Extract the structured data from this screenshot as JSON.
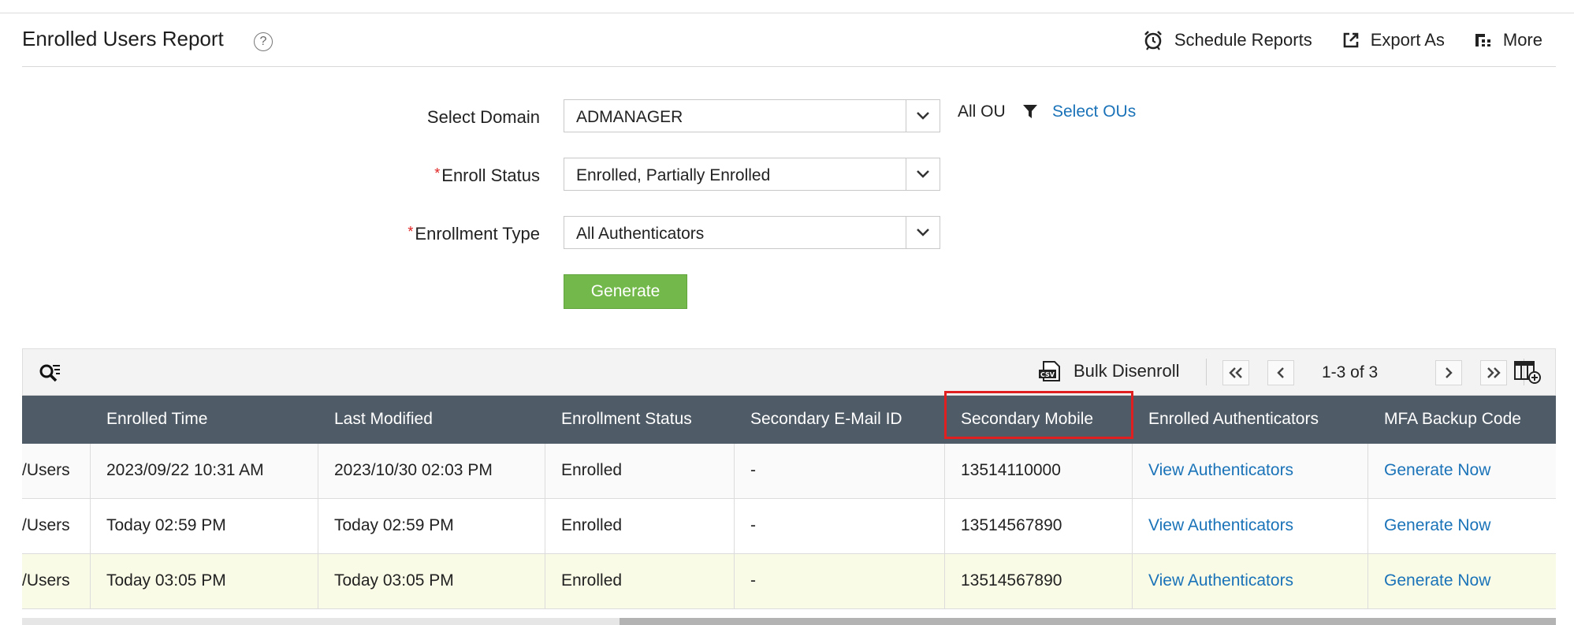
{
  "header": {
    "title": "Enrolled Users Report",
    "help_glyph": "?",
    "actions": [
      {
        "label": "Schedule Reports",
        "icon": "alarm-clock-icon"
      },
      {
        "label": "Export As",
        "icon": "export-icon"
      },
      {
        "label": "More",
        "icon": "more-icon"
      }
    ]
  },
  "form": {
    "domain_label": "Select Domain",
    "domain_value": "ADMANAGER",
    "status_label": "Enroll Status",
    "status_value": "Enrolled, Partially Enrolled",
    "type_label": "Enrollment Type",
    "type_value": "All Authenticators",
    "required_mark": "*",
    "ou_text": "All OU",
    "select_ous": "Select OUs",
    "generate_label": "Generate"
  },
  "toolbar": {
    "bulk_label": "Bulk Disenroll",
    "page_info": "1-3 of 3"
  },
  "table": {
    "headers": [
      "Enrolled Time",
      "Last Modified",
      "Enrollment Status",
      "Secondary E-Mail ID",
      "Secondary Mobile",
      "Enrolled Authenticators",
      "MFA Backup Code"
    ],
    "rows": [
      {
        "ou": "/Users",
        "enrolled_time": "2023/09/22 10:31 AM",
        "last_modified": "2023/10/30 02:03 PM",
        "status": "Enrolled",
        "email": "-",
        "mobile": "13514110000",
        "auth": "View Authenticators",
        "backup": "Generate Now"
      },
      {
        "ou": "/Users",
        "enrolled_time": "Today 02:59 PM",
        "last_modified": "Today 02:59 PM",
        "status": "Enrolled",
        "email": "-",
        "mobile": "13514567890",
        "auth": "View Authenticators",
        "backup": "Generate Now"
      },
      {
        "ou": "/Users",
        "enrolled_time": "Today 03:05 PM",
        "last_modified": "Today 03:05 PM",
        "status": "Enrolled",
        "email": "-",
        "mobile": "13514567890",
        "auth": "View Authenticators",
        "backup": "Generate Now"
      }
    ]
  },
  "colors": {
    "header_bg": "#4f5b66",
    "accent_green": "#72b84a",
    "link_blue": "#1a73b8",
    "highlight_red": "#e02020",
    "selected_row_bg": "#fafbe6"
  }
}
